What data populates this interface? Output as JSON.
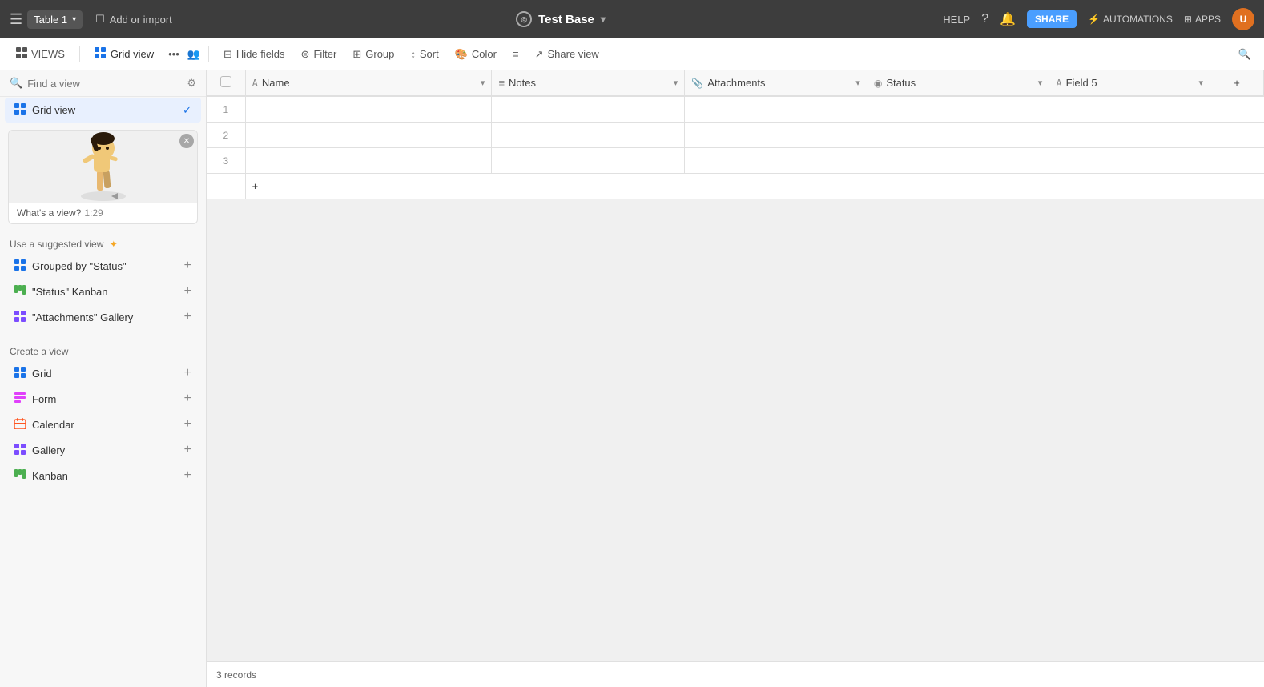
{
  "topbar": {
    "hamburger_label": "☰",
    "table_name": "Table 1",
    "table_chevron": "▾",
    "add_import_label": "Add or import",
    "db_title": "Test Base",
    "db_chevron": "▾",
    "help_label": "HELP",
    "share_label": "SHARE",
    "automations_label": "AUTOMATIONS",
    "apps_label": "APPS",
    "user_initials": "U"
  },
  "toolbar": {
    "views_label": "VIEWS",
    "grid_view_label": "Grid view",
    "hide_fields_label": "Hide fields",
    "filter_label": "Filter",
    "group_label": "Group",
    "sort_label": "Sort",
    "color_label": "Color",
    "share_view_label": "Share view"
  },
  "sidebar": {
    "search_placeholder": "Find a view",
    "views": [
      {
        "label": "Grid view",
        "active": true,
        "icon": "grid"
      }
    ],
    "media_label": "What's a view?",
    "media_time": "1:29",
    "suggested_title": "Use a suggested view",
    "suggested_items": [
      {
        "label": "Grouped by \"Status\"",
        "icon": "grid"
      },
      {
        "label": "\"Status\" Kanban",
        "icon": "kanban"
      },
      {
        "label": "\"Attachments\" Gallery",
        "icon": "gallery"
      }
    ],
    "create_title": "Create a view",
    "create_items": [
      {
        "label": "Grid",
        "icon": "grid"
      },
      {
        "label": "Form",
        "icon": "form"
      },
      {
        "label": "Calendar",
        "icon": "calendar"
      },
      {
        "label": "Gallery",
        "icon": "gallery"
      },
      {
        "label": "Kanban",
        "icon": "kanban"
      }
    ]
  },
  "grid": {
    "columns": [
      {
        "key": "name",
        "label": "Name",
        "icon": "A",
        "type": "text"
      },
      {
        "key": "notes",
        "label": "Notes",
        "icon": "≡",
        "type": "notes"
      },
      {
        "key": "attachments",
        "label": "Attachments",
        "icon": "📎",
        "type": "attach"
      },
      {
        "key": "status",
        "label": "Status",
        "icon": "◉",
        "type": "status"
      },
      {
        "key": "field5",
        "label": "Field 5",
        "icon": "A",
        "type": "text"
      }
    ],
    "rows": [
      {
        "num": 1
      },
      {
        "num": 2
      },
      {
        "num": 3
      }
    ],
    "add_col_label": "+",
    "add_row_label": "+",
    "footer_records": "3 records"
  }
}
